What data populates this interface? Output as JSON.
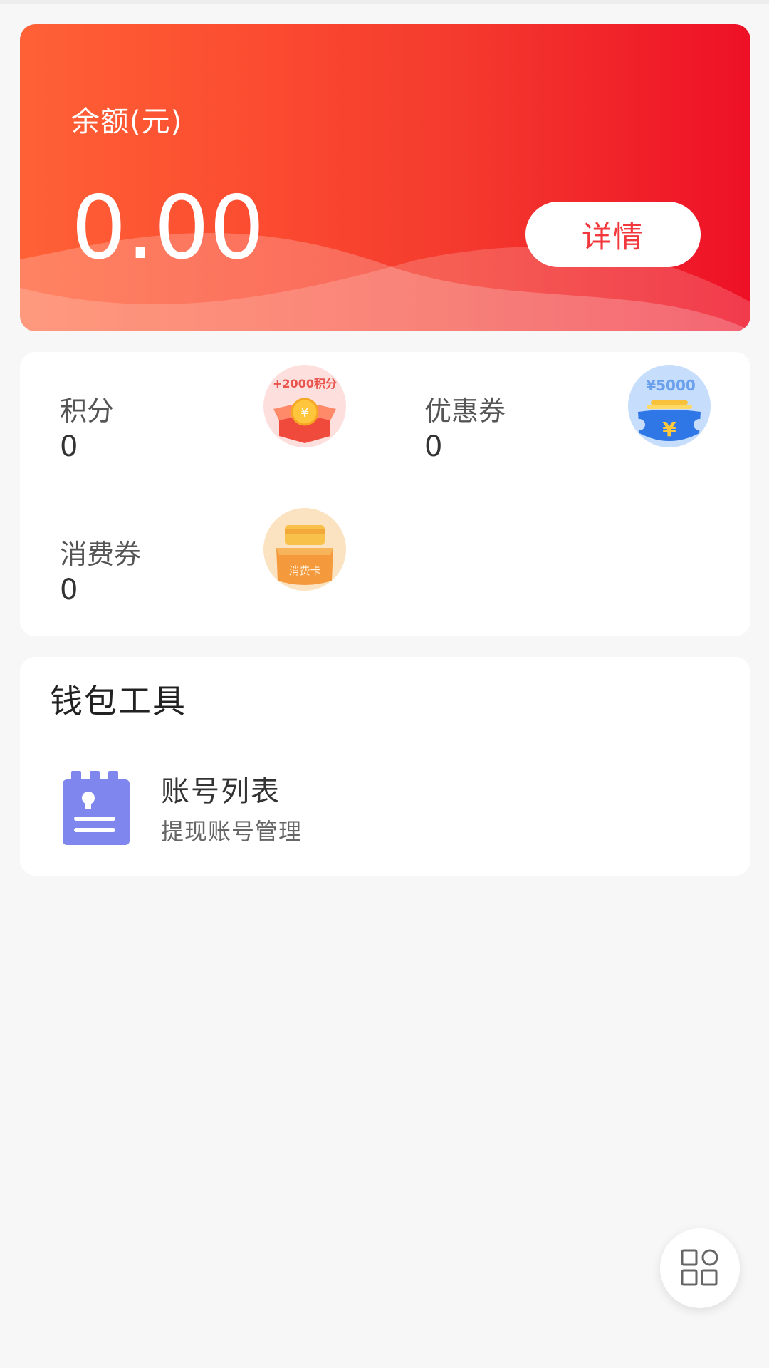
{
  "balance": {
    "label": "余额(元)",
    "value": "0.00",
    "detail_button": "详情"
  },
  "assets": [
    {
      "label": "积分",
      "value": "0",
      "icon": "points-gift-box-icon",
      "icon_text": "+2000积分"
    },
    {
      "label": "优惠券",
      "value": "0",
      "icon": "coupon-wallet-icon",
      "icon_text": "¥5000"
    },
    {
      "label": "消费券",
      "value": "0",
      "icon": "consumption-card-box-icon",
      "icon_text": "消费卡"
    }
  ],
  "tools": {
    "title": "钱包工具",
    "items": [
      {
        "title": "账号列表",
        "subtitle": "提现账号管理",
        "icon": "account-list-icon"
      }
    ]
  },
  "fab": {
    "icon": "grid-apps-icon"
  },
  "colors": {
    "brand_red": "#f3383d",
    "card_gradient_start": "#ff6136",
    "card_gradient_end": "#ee1026",
    "account_icon": "#7f86ee"
  }
}
